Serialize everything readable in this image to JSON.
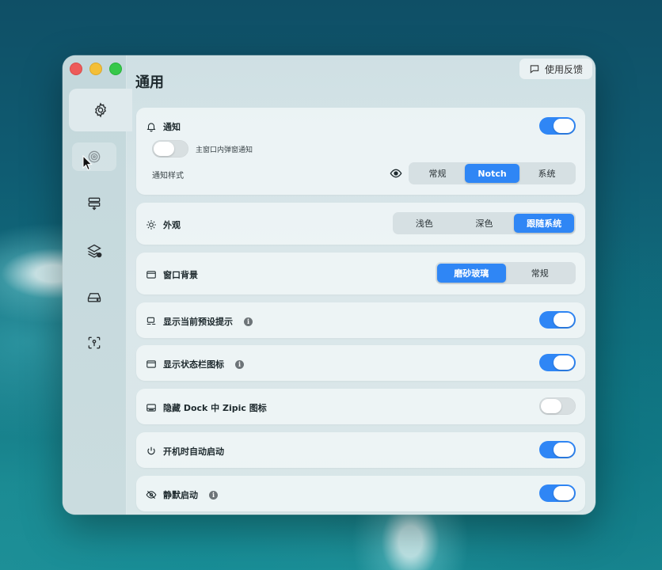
{
  "window": {
    "title": "通用",
    "feedback_label": "使用反馈"
  },
  "sidebar": {
    "items": [
      {
        "icon": "gear-icon",
        "active": true
      },
      {
        "icon": "target-icon",
        "active": false
      },
      {
        "icon": "stack-download-icon",
        "active": false
      },
      {
        "icon": "layers-icon",
        "active": false
      },
      {
        "icon": "drive-icon",
        "active": false
      },
      {
        "icon": "scan-icon",
        "active": false
      }
    ]
  },
  "settings": {
    "notifications": {
      "label": "通知",
      "enabled": true,
      "main_window_popup_label": "主窗口内弹窗通知",
      "main_window_popup_enabled": false,
      "style_label": "通知样式",
      "style_options": [
        "常规",
        "Notch",
        "系统"
      ],
      "style_selected": "Notch"
    },
    "appearance": {
      "label": "外观",
      "options": [
        "浅色",
        "深色",
        "跟随系统"
      ],
      "selected": "跟随系统"
    },
    "window_background": {
      "label": "窗口背景",
      "options": [
        "磨砂玻璃",
        "常规"
      ],
      "selected": "磨砂玻璃"
    },
    "show_preset_hint": {
      "label": "显示当前预设提示",
      "enabled": true
    },
    "show_statusbar_icon": {
      "label": "显示状态栏图标",
      "enabled": true
    },
    "hide_dock_icon": {
      "label": "隐藏 Dock 中 Zipic 图标",
      "enabled": false
    },
    "launch_at_login": {
      "label": "开机时自动启动",
      "enabled": true
    },
    "silent_launch": {
      "label": "静默启动",
      "enabled": true
    }
  },
  "colors": {
    "accent": "#2f86f5",
    "traffic_red": "#ed5b5a",
    "traffic_yellow": "#f4bf37",
    "traffic_green": "#36c84a"
  }
}
